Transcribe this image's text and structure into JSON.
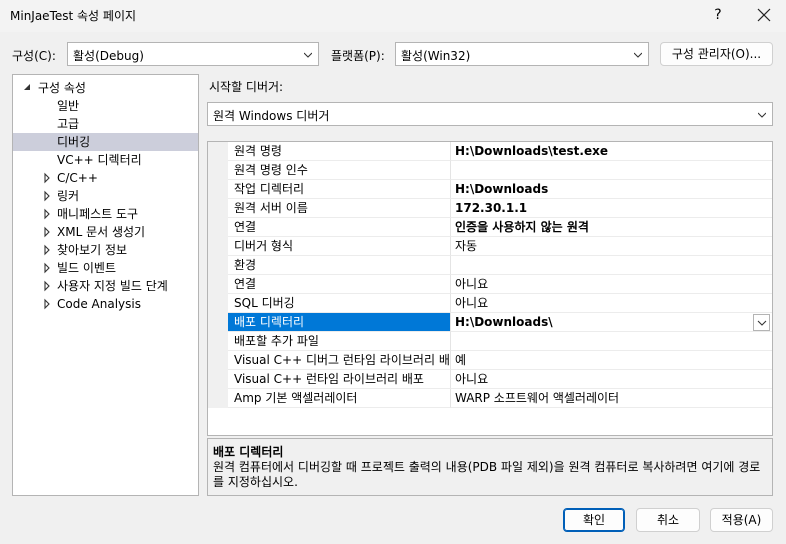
{
  "window": {
    "title": "MinJaeTest 속성 페이지",
    "help_label": "?"
  },
  "toolbar": {
    "config_label": "구성(C):",
    "config_value": "활성(Debug)",
    "platform_label": "플랫폼(P):",
    "platform_value": "활성(Win32)",
    "config_manager_label": "구성 관리자(O)..."
  },
  "tree": {
    "root": "구성 속성",
    "items": [
      {
        "label": "일반",
        "expandable": false
      },
      {
        "label": "고급",
        "expandable": false
      },
      {
        "label": "디버깅",
        "expandable": false,
        "selected": true
      },
      {
        "label": "VC++ 디렉터리",
        "expandable": false
      },
      {
        "label": "C/C++",
        "expandable": true
      },
      {
        "label": "링커",
        "expandable": true
      },
      {
        "label": "매니페스트 도구",
        "expandable": true
      },
      {
        "label": "XML 문서 생성기",
        "expandable": true
      },
      {
        "label": "찾아보기 정보",
        "expandable": true
      },
      {
        "label": "빌드 이벤트",
        "expandable": true
      },
      {
        "label": "사용자 지정 빌드 단계",
        "expandable": true
      },
      {
        "label": "Code Analysis",
        "expandable": true
      }
    ]
  },
  "debugger": {
    "label": "시작할 디버거:",
    "value": "원격 Windows 디버거"
  },
  "properties": [
    {
      "name": "원격 명령",
      "value": "H:\\Downloads\\test.exe",
      "bold": true
    },
    {
      "name": "원격 명령 인수",
      "value": "",
      "bold": false
    },
    {
      "name": "작업 디렉터리",
      "value": "H:\\Downloads",
      "bold": true
    },
    {
      "name": "원격 서버 이름",
      "value": "172.30.1.1",
      "bold": true
    },
    {
      "name": "연결",
      "value": "인증을 사용하지 않는 원격",
      "bold": true
    },
    {
      "name": "디버거 형식",
      "value": "자동",
      "bold": false
    },
    {
      "name": "환경",
      "value": "",
      "bold": false
    },
    {
      "name": "연결",
      "value": "아니요",
      "bold": false
    },
    {
      "name": "SQL 디버깅",
      "value": "아니요",
      "bold": false
    },
    {
      "name": "배포 디렉터리",
      "value": "H:\\Downloads\\",
      "bold": true,
      "selected": true
    },
    {
      "name": "배포할 추가 파일",
      "value": "",
      "bold": false
    },
    {
      "name": "Visual C++ 디버그 런타임 라이브러리 배",
      "value": "예",
      "bold": false
    },
    {
      "name": "Visual C++ 런타임 라이브러리 배포",
      "value": "아니요",
      "bold": false
    },
    {
      "name": "Amp 기본 액셀러레이터",
      "value": "WARP 소프트웨어 액셀러레이터",
      "bold": false
    }
  ],
  "description": {
    "title": "배포 디렉터리",
    "text": "원격 컴퓨터에서 디버깅할 때 프로젝트 출력의 내용(PDB 파일 제외)을 원격 컴퓨터로 복사하려면 여기에 경로를 지정하십시오."
  },
  "buttons": {
    "ok": "확인",
    "cancel": "취소",
    "apply": "적용(A)"
  },
  "colors": {
    "selection_blue": "#0078d7",
    "tree_selection": "#cccedb",
    "primary_border": "#005fb8"
  }
}
